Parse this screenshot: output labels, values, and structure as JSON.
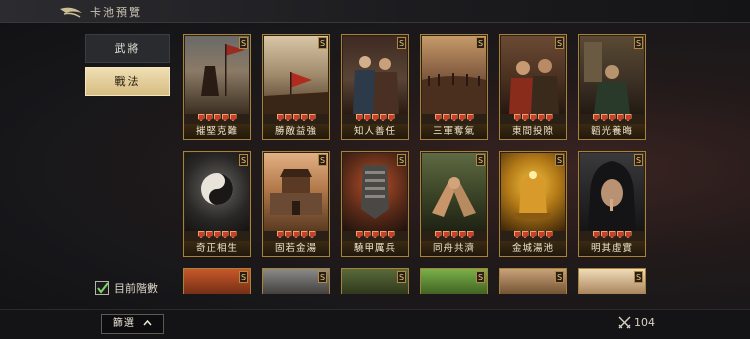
{
  "header": {
    "title": "卡池預覽"
  },
  "tabs": [
    {
      "label": "武將",
      "active": false
    },
    {
      "label": "戰法",
      "active": true
    }
  ],
  "checkbox": {
    "label": "目前階數",
    "checked": true
  },
  "cards": [
    {
      "name": "摧堅克難",
      "rank": "S"
    },
    {
      "name": "勝敵益強",
      "rank": "S"
    },
    {
      "name": "知人善任",
      "rank": "S"
    },
    {
      "name": "三軍奪氣",
      "rank": "S"
    },
    {
      "name": "東間投隙",
      "rank": "S"
    },
    {
      "name": "韜光養晦",
      "rank": "S"
    },
    {
      "name": "奇正相生",
      "rank": "S"
    },
    {
      "name": "固若金湯",
      "rank": "S"
    },
    {
      "name": "驍甲厲兵",
      "rank": "S"
    },
    {
      "name": "同舟共濟",
      "rank": "S"
    },
    {
      "name": "金城湯池",
      "rank": "S"
    },
    {
      "name": "明其虛實",
      "rank": "S"
    }
  ],
  "partial_cards": [
    {
      "rank": "S"
    },
    {
      "rank": "S"
    },
    {
      "rank": "S"
    },
    {
      "rank": "S"
    },
    {
      "rank": "S"
    },
    {
      "rank": "S"
    }
  ],
  "footer": {
    "filter_label": "篩選",
    "count": "104"
  },
  "colors": {
    "accent_gold": "#d6bc82",
    "card_border": "#a68338"
  }
}
